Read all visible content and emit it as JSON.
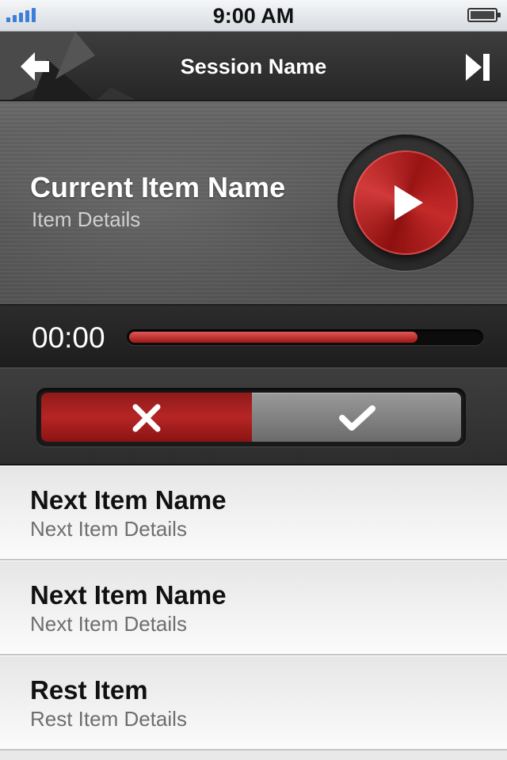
{
  "status_bar": {
    "time": "9:00 AM",
    "icons": [
      "signal-icon",
      "battery-icon"
    ],
    "signal_color": "#3d7fd8"
  },
  "nav": {
    "title": "Session Name",
    "back_icon": "arrow-left-icon",
    "skip_icon": "skip-next-icon"
  },
  "current_item": {
    "name": "Current Item Name",
    "details": "Item Details",
    "play_icon": "play-icon"
  },
  "progress": {
    "elapsed": "00:00",
    "fraction": 0.82,
    "fill_color": "#b02020"
  },
  "toggle": {
    "left_icon": "close-icon",
    "right_icon": "check-icon",
    "left_color": "#a51f1f",
    "right_color": "#888888"
  },
  "list": {
    "items": [
      {
        "name": "Next Item Name",
        "details": "Next Item Details"
      },
      {
        "name": "Next Item Name",
        "details": "Next Item Details"
      },
      {
        "name": "Rest Item",
        "details": "Rest Item Details"
      }
    ]
  }
}
